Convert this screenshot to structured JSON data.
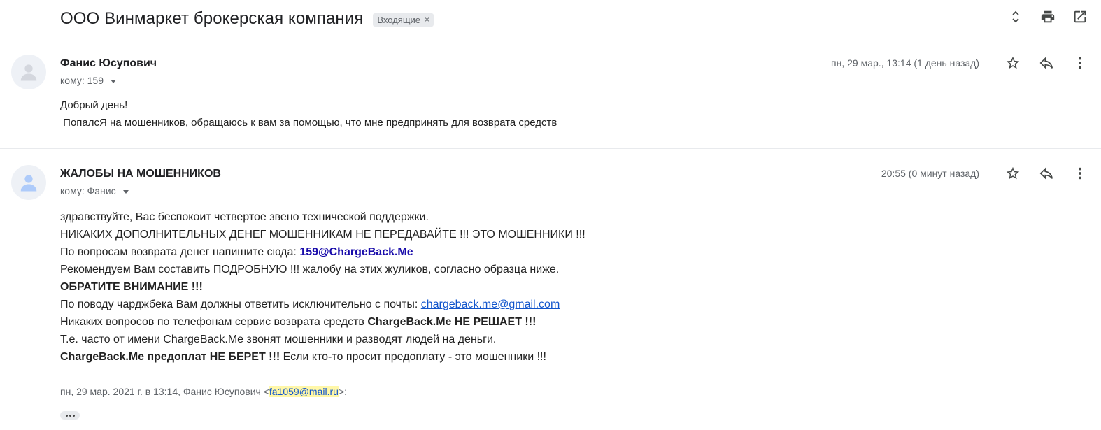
{
  "thread": {
    "subject": "ООО Винмаркет брокерская компания",
    "label": "Входящие",
    "label_remove": "×"
  },
  "top_actions": [
    "expand-collapse-icon",
    "print-icon",
    "open-new-window-icon"
  ],
  "messages": [
    {
      "sender": "Фанис Юсупович",
      "to": "кому: 159",
      "date": "пн, 29 мар., 13:14 (1 день назад)",
      "body": [
        "Добрый день!",
        " ПопалсЯ на мошенников, обращаюсь к вам за помощью, что мне предпринять для возврата средств"
      ]
    },
    {
      "sender": "ЖАЛОБЫ НА МОШЕННИКОВ",
      "to": "кому: Фанис",
      "date": "20:55 (0 минут назад)",
      "body": {
        "l1": "здравствуйте, Вас беспокоит четвертое звено технической поддержки.",
        "l2": "НИКАКИХ ДОПОЛНИТЕЛЬНЫХ ДЕНЕГ МОШЕННИКАМ НЕ ПЕРЕДАВАЙТЕ !!! ЭТО МОШЕННИКИ !!!",
        "l3_prefix": "По вопросам возврата денег напишите сюда: ",
        "l3_link": "159@ChargeBack.Me",
        "l4": "Рекомендуем Вам составить ПОДРОБНУЮ !!! жалобу на этих жуликов, согласно образца ниже.",
        "l5": "ОБРАТИТЕ ВНИМАНИЕ !!!",
        "l6_prefix": "По поводу чарджбека Вам должны ответить исключительно с почты: ",
        "l6_link": "chargeback.me@gmail.com",
        "l7_prefix": "Никаких вопросов по телефонам сервис возврата средств ",
        "l7_bold": "ChargeBack.Me НЕ РЕШАЕТ !!!",
        "l8": "Т.е. часто от имени ChargeBack.Me звонят мошенники и разводят людей на деньги.",
        "l9_bold": "ChargeBack.Me предоплат НЕ БЕРЕТ !!!",
        "l9_rest": " Если кто-то просит предоплату - это мошенники !!!"
      },
      "quote_prefix": "пн, 29 мар. 2021 г. в 13:14, Фанис Юсупович <",
      "quote_email": "fa1059@mail.ru",
      "quote_suffix": ">:"
    }
  ],
  "message_actions": [
    "star-icon",
    "reply-icon",
    "more-vert-icon"
  ],
  "colors": {
    "link": "#1155cc",
    "link_bold": "#1a0dab",
    "highlight": "#fff7a8",
    "muted": "#5f6368"
  }
}
